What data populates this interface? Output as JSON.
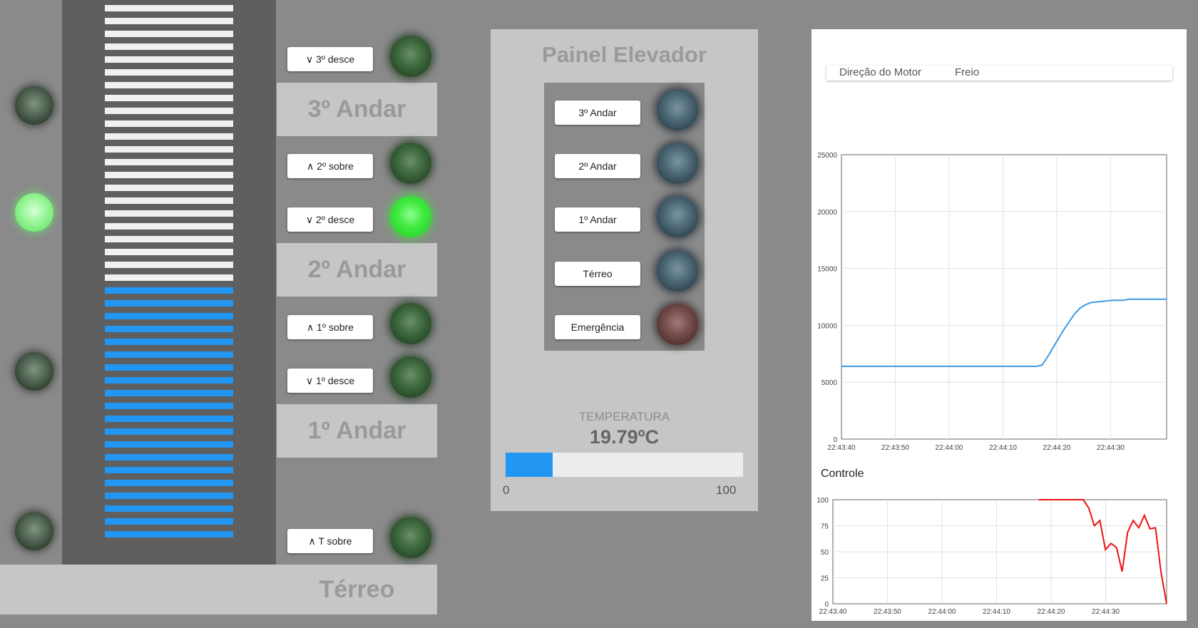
{
  "floor_labels": {
    "third": "3º Andar",
    "second": "2º Andar",
    "first": "1º Andar",
    "ground": "Térreo"
  },
  "call_buttons": {
    "third_down": "∨ 3º desce",
    "second_up": "∧ 2º sobre",
    "second_down": "∨ 2º desce",
    "first_up": "∧ 1º sobre",
    "first_down": "∨ 1º desce",
    "ground_up": "∧ T sobre"
  },
  "elevator_position": {
    "filled_fraction": 0.48,
    "stripes_total": 42,
    "stripes_filled": 20
  },
  "panel": {
    "title": "Painel Elevador",
    "buttons": {
      "third": "3º Andar",
      "second": "2º Andar",
      "first": "1º Andar",
      "ground": "Térreo",
      "emergency": "Emergência"
    },
    "temperature_label": "TEMPERATURA",
    "temperature_value": "19.79ºC",
    "temperature_fraction": 0.1979,
    "scale_min": "0",
    "scale_max": "100"
  },
  "legend": {
    "items": [
      "Direção do Motor",
      "Freio"
    ]
  },
  "colors": {
    "accent_blue": "#2196f3",
    "led_green": "#3ee83e",
    "line_red": "#ee1111",
    "line_blue": "#3d9be5"
  },
  "chart_data": [
    {
      "type": "line",
      "x": [
        "22:43:40",
        "22:43:50",
        "22:44:00",
        "22:44:10",
        "22:44:20",
        "22:44:30"
      ],
      "ylim": [
        0,
        25000
      ],
      "yticks": [
        "25000",
        "20000",
        "15000",
        "10000",
        "5000",
        "0"
      ],
      "series": [
        {
          "points": [
            [
              0,
              6400
            ],
            [
              36,
              6400
            ],
            [
              37,
              6500
            ],
            [
              38,
              7200
            ],
            [
              39,
              8000
            ],
            [
              40,
              8800
            ],
            [
              41,
              9600
            ],
            [
              42,
              10300
            ],
            [
              43,
              11000
            ],
            [
              44,
              11500
            ],
            [
              45,
              11800
            ],
            [
              46,
              12000
            ],
            [
              48,
              12100
            ],
            [
              50,
              12200
            ],
            [
              52,
              12200
            ],
            [
              53,
              12300
            ],
            [
              60,
              12300
            ]
          ]
        }
      ]
    },
    {
      "type": "line",
      "title": "Controle",
      "x": [
        "22:43:40",
        "22:43:50",
        "22:44:00",
        "22:44:10",
        "22:44:20",
        "22:44:30"
      ],
      "ylim": [
        0,
        100
      ],
      "yticks": [
        "100",
        "75",
        "50",
        "25",
        "0"
      ],
      "series": [
        {
          "points": [
            [
              37,
              100
            ],
            [
              41,
              100
            ],
            [
              45,
              100
            ],
            [
              46,
              92
            ],
            [
              47,
              75
            ],
            [
              48,
              80
            ],
            [
              49,
              52
            ],
            [
              50,
              58
            ],
            [
              51,
              54
            ],
            [
              52,
              31
            ],
            [
              53,
              69
            ],
            [
              54,
              80
            ],
            [
              55,
              73
            ],
            [
              56,
              85
            ],
            [
              57,
              72
            ],
            [
              58,
              73
            ],
            [
              59,
              30
            ],
            [
              60,
              0
            ]
          ]
        }
      ]
    }
  ]
}
